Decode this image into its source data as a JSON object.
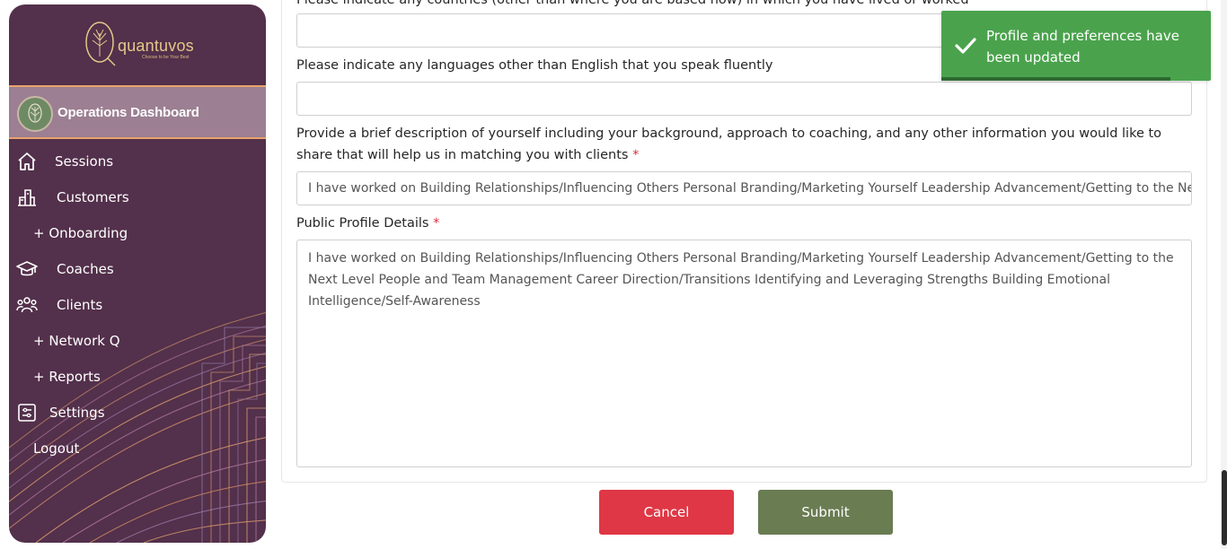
{
  "brand": {
    "name": "quantuvos",
    "tagline": "Choose to be Your Best"
  },
  "sidebar": {
    "dashboard_label": "Operations Dashboard",
    "items": [
      {
        "label": "Sessions",
        "icon": "home-icon"
      },
      {
        "label": "Customers",
        "icon": "building-icon"
      },
      {
        "label": "+ Onboarding",
        "icon": ""
      },
      {
        "label": "Coaches",
        "icon": "graduation-cap-icon"
      },
      {
        "label": "Clients",
        "icon": "users-icon"
      },
      {
        "label": "+ Network Q",
        "icon": ""
      },
      {
        "label": "+ Reports",
        "icon": ""
      },
      {
        "label": "Settings",
        "icon": "settings-panel-icon"
      },
      {
        "label": "Logout",
        "icon": ""
      }
    ]
  },
  "form": {
    "countries_label": "Please indicate any countries (other than where you are based now) in which you have lived or worked",
    "countries_value": "",
    "languages_label": "Please indicate any languages other than English that you speak fluently",
    "languages_value": "",
    "description_label": "Provide a brief description of yourself including your background, approach to coaching, and any other information you would like to share that will help us in matching you with clients",
    "description_value": "I have worked on Building Relationships/Influencing Others Personal Branding/Marketing Yourself Leadership Advancement/Getting to the Next Level People and Team Management Career Direction/Transitions Identifying and Leveraging Strengths Building Emotional Intelligence/Self-Awareness",
    "public_profile_label": "Public Profile Details",
    "public_profile_value": "I have worked on Building Relationships/Influencing Others Personal Branding/Marketing Yourself Leadership Advancement/Getting to the Next Level People and Team Management Career Direction/Transitions Identifying and Leveraging Strengths Building Emotional Intelligence/Self-Awareness",
    "required_marker": "*"
  },
  "actions": {
    "cancel_label": "Cancel",
    "submit_label": "Submit"
  },
  "toast": {
    "message": "Profile and preferences have been updated",
    "icon": "check-icon",
    "progress": 0.85
  },
  "colors": {
    "sidebar_bg": "#53304b",
    "sidebar_active": "#9c7f92",
    "accent_orange": "#e8a36a",
    "cancel_red": "#df3745",
    "submit_green": "#6a7c52",
    "toast_green": "#4aa34c"
  }
}
